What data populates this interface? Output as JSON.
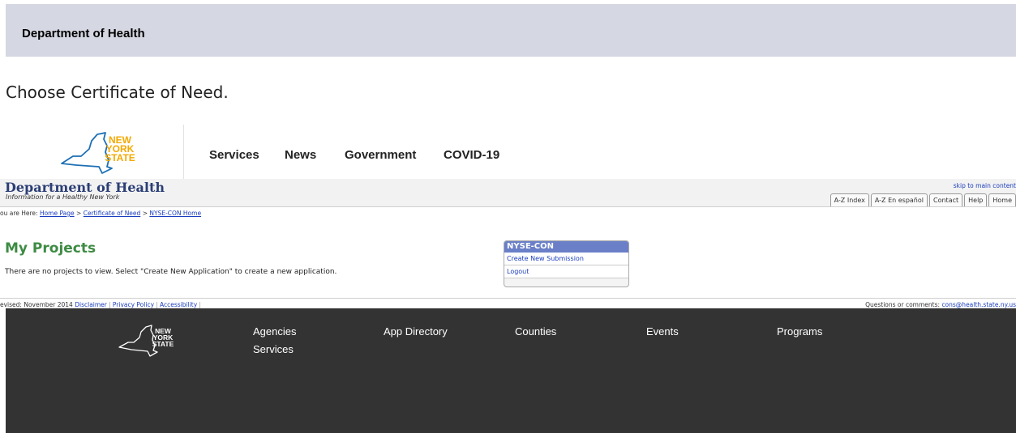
{
  "doc_header": {
    "title": "Department of Health"
  },
  "instruction": "Choose Certificate of Need.",
  "site_logo": {
    "lines": [
      "NEW",
      "YORK",
      "STATE"
    ]
  },
  "top_nav": [
    "Services",
    "News",
    "Government",
    "COVID-19"
  ],
  "doh_banner": {
    "title": "Department of Health",
    "subtitle": "Information for a Healthy New York",
    "skip_link": "skip to main content",
    "tabs": [
      "A-Z Index",
      "A-Z En español",
      "Contact",
      "Help",
      "Home"
    ]
  },
  "breadcrumb": {
    "prefix": "ou are Here:",
    "items": [
      "Home Page",
      "Certificate of Need",
      "NYSE-CON Home"
    ],
    "separator": ">"
  },
  "main": {
    "heading": "My Projects",
    "message": "There are no projects to view. Select \"Create New Application\" to create a new application."
  },
  "nysecon_box": {
    "title": "NYSE-CON",
    "links": [
      "Create New Submission",
      "Logout"
    ]
  },
  "footer_info": {
    "revised": "evised: November 2014",
    "links": [
      "Disclaimer",
      "Privacy Policy",
      "Accessibility"
    ],
    "questions_label": "Questions or comments:",
    "email": "cons@health.state.ny.us"
  },
  "dark_footer": {
    "logo_lines": [
      "NEW",
      "YORK",
      "STATE"
    ],
    "links": [
      "Agencies",
      "App Directory",
      "Counties",
      "Events",
      "Programs",
      "Services"
    ]
  },
  "colors": {
    "header_bg": "#d5d7e2",
    "doh_blue": "#2b3e75",
    "heading_green": "#3e8b44",
    "link_blue": "#1a3dbd",
    "footer_dark": "#333333",
    "logo_gold": "#f2a900",
    "logo_blue": "#1d6fb5"
  }
}
